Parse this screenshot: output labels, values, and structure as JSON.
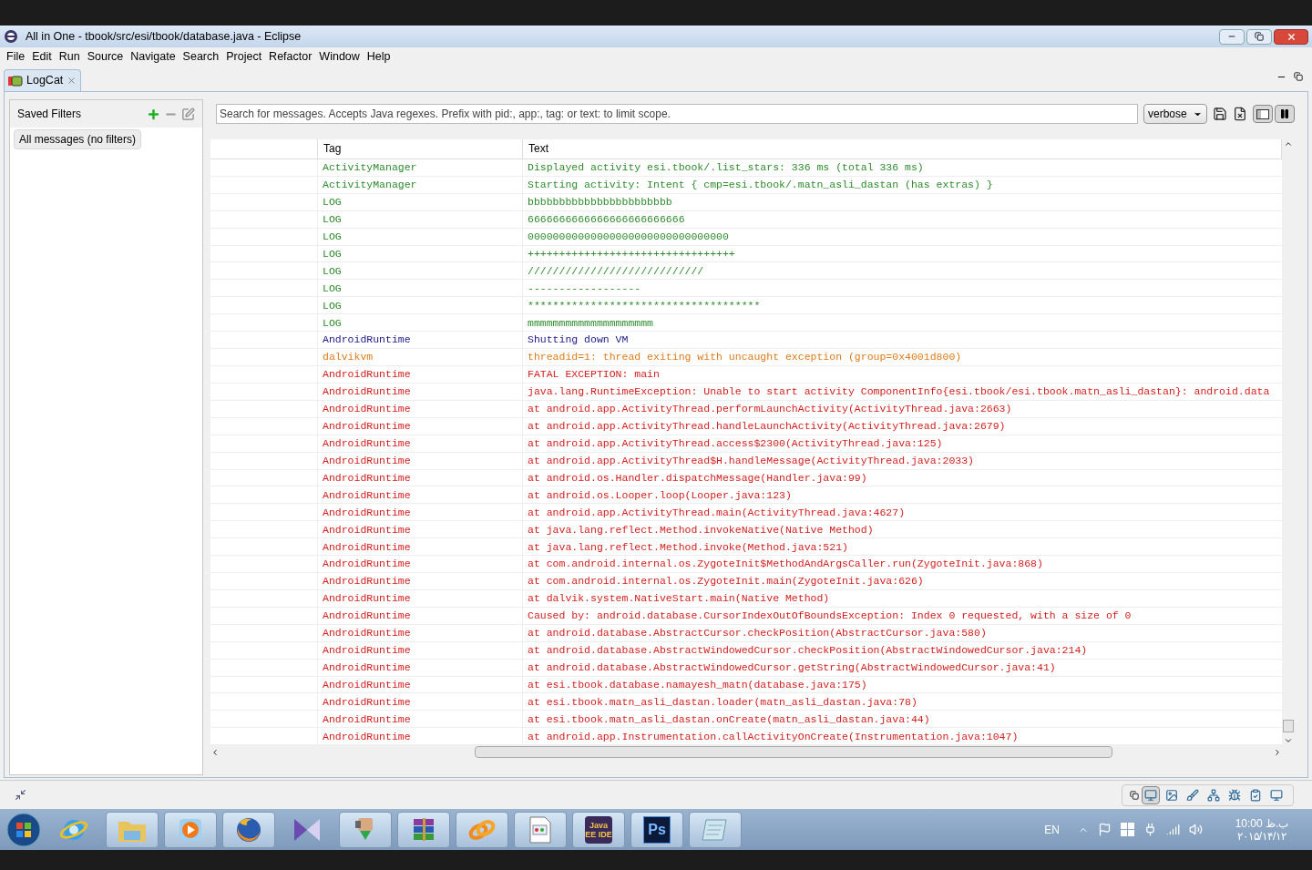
{
  "window": {
    "title": "All in One - tbook/src/esi/tbook/database.java - Eclipse"
  },
  "menu": [
    "File",
    "Edit",
    "Run",
    "Source",
    "Navigate",
    "Search",
    "Project",
    "Refactor",
    "Window",
    "Help"
  ],
  "tabs": [
    {
      "label": "LogCat",
      "selected": true
    }
  ],
  "filters": {
    "title": "Saved Filters",
    "items": [
      {
        "label": "All messages (no filters)",
        "selected": true
      }
    ]
  },
  "search": {
    "placeholder": "Search for messages. Accepts Java regexes. Prefix with pid:, app:, tag: or text: to limit scope."
  },
  "log_level": "verbose",
  "toggles": [
    {
      "kind": "split",
      "pressed": true
    },
    {
      "kind": "pause",
      "pressed": true
    }
  ],
  "table": {
    "columns": [
      "Tag",
      "Text"
    ],
    "rows": [
      {
        "kind": "info",
        "tag": "ActivityManager",
        "text": "Displayed activity esi.tbook/.list_stars: 336 ms (total 336 ms)"
      },
      {
        "kind": "info",
        "tag": "ActivityManager",
        "text": "Starting activity: Intent { cmp=esi.tbook/.matn_asli_dastan (has extras) }"
      },
      {
        "kind": "info",
        "tag": "LOG",
        "text": "bbbbbbbbbbbbbbbbbbbbbbb"
      },
      {
        "kind": "info",
        "tag": "LOG",
        "text": "6666666666666666666666666"
      },
      {
        "kind": "info",
        "tag": "LOG",
        "text": "00000000000000000000000000000000"
      },
      {
        "kind": "info",
        "tag": "LOG",
        "text": "+++++++++++++++++++++++++++++++++"
      },
      {
        "kind": "info",
        "tag": "LOG",
        "text": "////////////////////////////"
      },
      {
        "kind": "info",
        "tag": "LOG",
        "text": "------------------"
      },
      {
        "kind": "info",
        "tag": "LOG",
        "text": "*************************************"
      },
      {
        "kind": "info",
        "tag": "LOG",
        "text": "mmmmmmmmmmmmmmmmmmmm"
      },
      {
        "kind": "debug",
        "tag": "AndroidRuntime",
        "text": "Shutting down VM"
      },
      {
        "kind": "warn",
        "tag": "dalvikvm",
        "text": "threadid=1: thread exiting with uncaught exception (group=0x4001d800)"
      },
      {
        "kind": "error",
        "tag": "AndroidRuntime",
        "text": "FATAL EXCEPTION: main"
      },
      {
        "kind": "error",
        "tag": "AndroidRuntime",
        "text": "java.lang.RuntimeException: Unable to start activity ComponentInfo{esi.tbook/esi.tbook.matn_asli_dastan}: android.data"
      },
      {
        "kind": "error",
        "tag": "AndroidRuntime",
        "text": "at android.app.ActivityThread.performLaunchActivity(ActivityThread.java:2663)"
      },
      {
        "kind": "error",
        "tag": "AndroidRuntime",
        "text": "at android.app.ActivityThread.handleLaunchActivity(ActivityThread.java:2679)"
      },
      {
        "kind": "error",
        "tag": "AndroidRuntime",
        "text": "at android.app.ActivityThread.access$2300(ActivityThread.java:125)"
      },
      {
        "kind": "error",
        "tag": "AndroidRuntime",
        "text": "at android.app.ActivityThread$H.handleMessage(ActivityThread.java:2033)"
      },
      {
        "kind": "error",
        "tag": "AndroidRuntime",
        "text": "at android.os.Handler.dispatchMessage(Handler.java:99)"
      },
      {
        "kind": "error",
        "tag": "AndroidRuntime",
        "text": "at android.os.Looper.loop(Looper.java:123)"
      },
      {
        "kind": "error",
        "tag": "AndroidRuntime",
        "text": "at android.app.ActivityThread.main(ActivityThread.java:4627)"
      },
      {
        "kind": "error",
        "tag": "AndroidRuntime",
        "text": "at java.lang.reflect.Method.invokeNative(Native Method)"
      },
      {
        "kind": "error",
        "tag": "AndroidRuntime",
        "text": "at java.lang.reflect.Method.invoke(Method.java:521)"
      },
      {
        "kind": "error",
        "tag": "AndroidRuntime",
        "text": "at com.android.internal.os.ZygoteInit$MethodAndArgsCaller.run(ZygoteInit.java:868)"
      },
      {
        "kind": "error",
        "tag": "AndroidRuntime",
        "text": "at com.android.internal.os.ZygoteInit.main(ZygoteInit.java:626)"
      },
      {
        "kind": "error",
        "tag": "AndroidRuntime",
        "text": "at dalvik.system.NativeStart.main(Native Method)"
      },
      {
        "kind": "error",
        "tag": "AndroidRuntime",
        "text": "Caused by: android.database.CursorIndexOutOfBoundsException: Index 0 requested, with a size of 0"
      },
      {
        "kind": "error",
        "tag": "AndroidRuntime",
        "text": "at android.database.AbstractCursor.checkPosition(AbstractCursor.java:580)"
      },
      {
        "kind": "error",
        "tag": "AndroidRuntime",
        "text": "at android.database.AbstractWindowedCursor.checkPosition(AbstractWindowedCursor.java:214)"
      },
      {
        "kind": "error",
        "tag": "AndroidRuntime",
        "text": "at android.database.AbstractWindowedCursor.getString(AbstractWindowedCursor.java:41)"
      },
      {
        "kind": "error",
        "tag": "AndroidRuntime",
        "text": "at esi.tbook.database.namayesh_matn(database.java:175)"
      },
      {
        "kind": "error",
        "tag": "AndroidRuntime",
        "text": "at esi.tbook.matn_asli_dastan.loader(matn_asli_dastan.java:78)"
      },
      {
        "kind": "error",
        "tag": "AndroidRuntime",
        "text": "at esi.tbook.matn_asli_dastan.onCreate(matn_asli_dastan.java:44)"
      },
      {
        "kind": "error",
        "tag": "AndroidRuntime",
        "text": "at android.app.Instrumentation.callActivityOnCreate(Instrumentation.java:1047)"
      }
    ]
  },
  "perspectives": [
    {
      "kind": "logcat",
      "selected": true
    },
    {
      "kind": "image",
      "selected": false
    },
    {
      "kind": "brush",
      "selected": false
    },
    {
      "kind": "tree",
      "selected": false
    },
    {
      "kind": "bug",
      "selected": false
    },
    {
      "kind": "clipboard",
      "selected": false
    },
    {
      "kind": "monitor",
      "selected": false
    }
  ],
  "taskbar": {
    "items": [
      {
        "kind": "ie",
        "running": false
      },
      {
        "kind": "folder",
        "running": true
      },
      {
        "kind": "media",
        "running": true
      },
      {
        "kind": "firefox",
        "running": true
      },
      {
        "kind": "vs",
        "running": false
      },
      {
        "kind": "download",
        "running": true
      },
      {
        "kind": "archive",
        "running": true
      },
      {
        "kind": "audio",
        "running": true
      },
      {
        "kind": "document",
        "running": true
      },
      {
        "kind": "java",
        "running": true,
        "label": "Java EE IDE"
      },
      {
        "kind": "ps",
        "running": true,
        "label": "Ps"
      },
      {
        "kind": "notepad",
        "running": true
      }
    ],
    "language": "EN",
    "time": "10:00 ب.ظ",
    "date": "۲۰۱۵/۱۴/۱۲"
  }
}
